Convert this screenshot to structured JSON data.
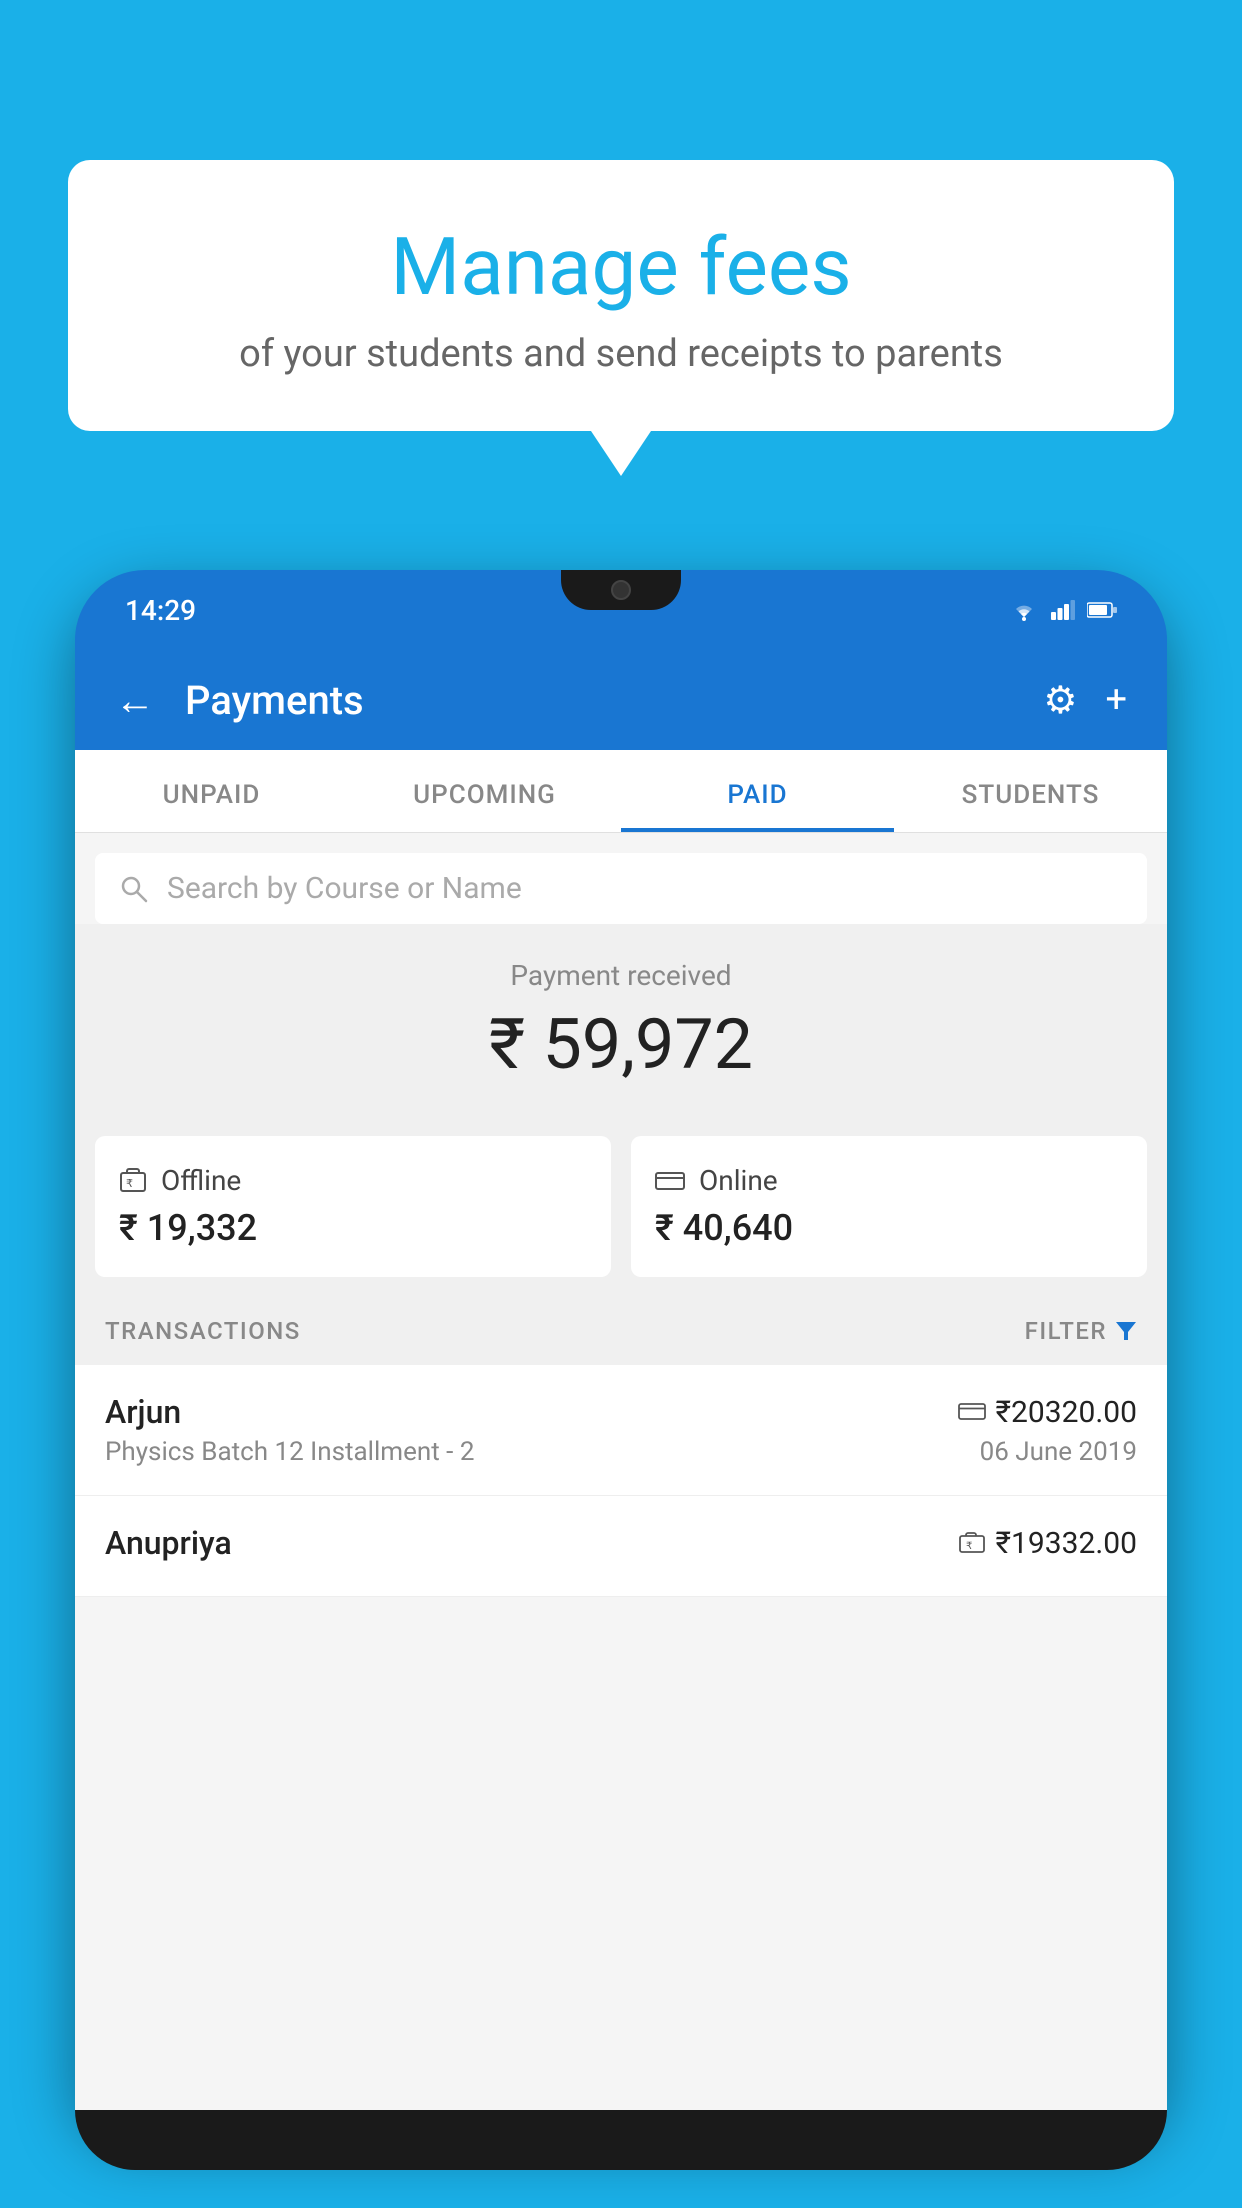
{
  "background_color": "#1ab0e8",
  "speech_bubble": {
    "title": "Manage fees",
    "subtitle": "of your students and send receipts to parents"
  },
  "phone": {
    "status_bar": {
      "time": "14:29",
      "icons": [
        "wifi",
        "signal",
        "battery"
      ]
    },
    "header": {
      "title": "Payments",
      "back_label": "←",
      "settings_icon": "⚙",
      "add_icon": "+"
    },
    "tabs": [
      {
        "label": "UNPAID",
        "active": false
      },
      {
        "label": "UPCOMING",
        "active": false
      },
      {
        "label": "PAID",
        "active": true
      },
      {
        "label": "STUDENTS",
        "active": false
      }
    ],
    "search": {
      "placeholder": "Search by Course or Name"
    },
    "payment_section": {
      "label": "Payment received",
      "amount": "₹ 59,972",
      "cards": [
        {
          "icon": "offline",
          "label": "Offline",
          "amount": "₹ 19,332"
        },
        {
          "icon": "online",
          "label": "Online",
          "amount": "₹ 40,640"
        }
      ]
    },
    "transactions": {
      "header_label": "TRANSACTIONS",
      "filter_label": "FILTER",
      "rows": [
        {
          "name": "Arjun",
          "course": "Physics Batch 12 Installment - 2",
          "amount": "₹20320.00",
          "date": "06 June 2019",
          "payment_type": "online"
        },
        {
          "name": "Anupriya",
          "course": "",
          "amount": "₹19332.00",
          "date": "",
          "payment_type": "offline"
        }
      ]
    }
  }
}
